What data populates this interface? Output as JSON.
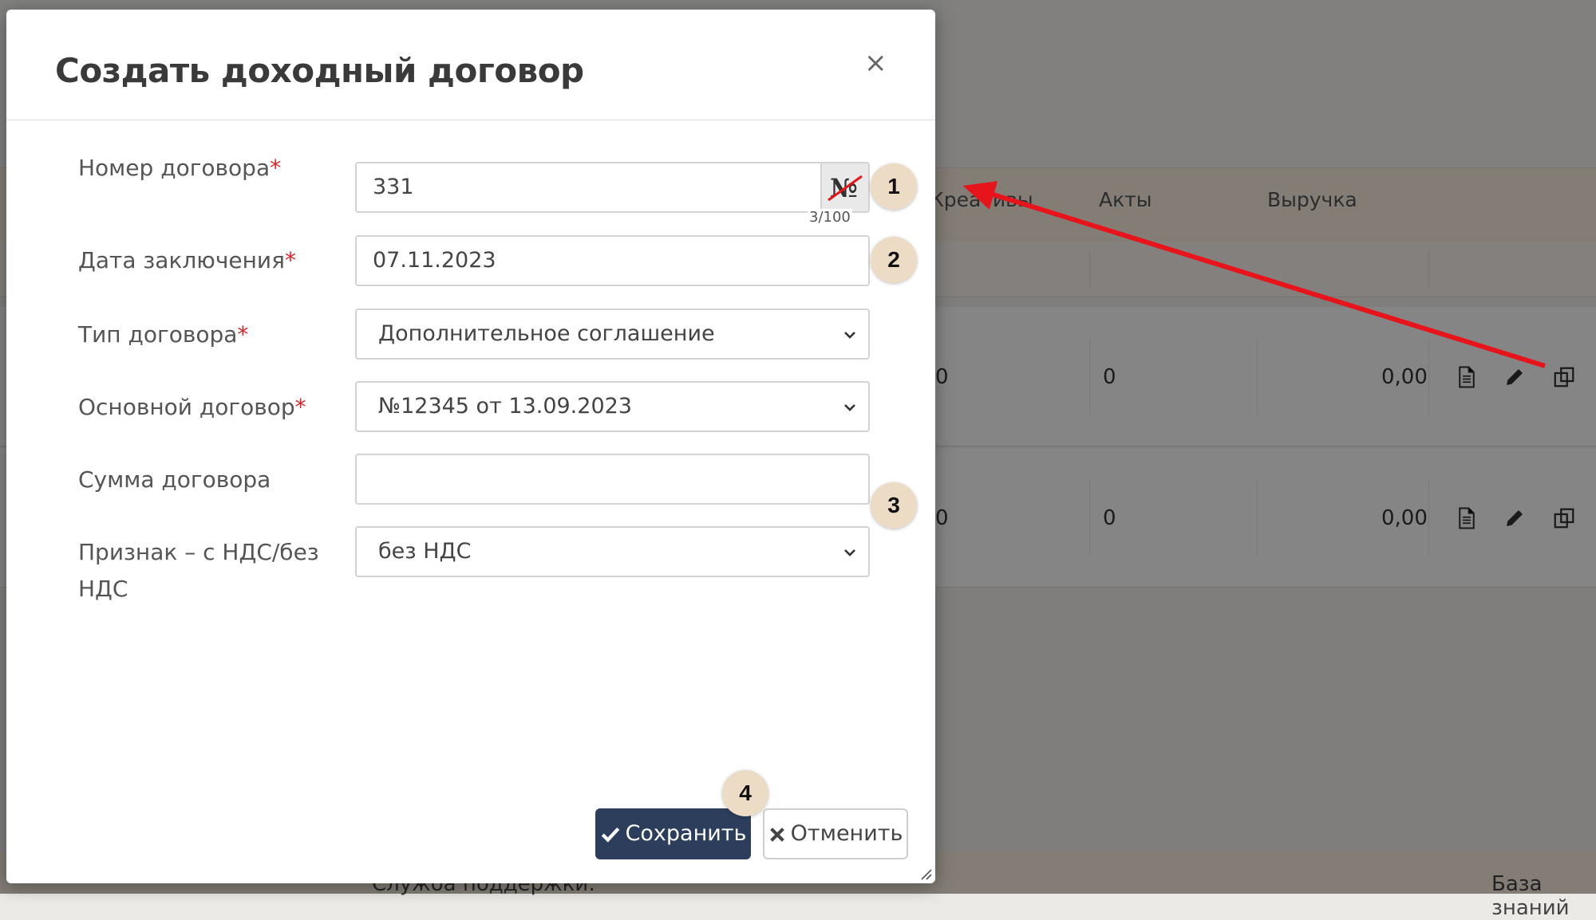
{
  "background": {
    "columns": [
      "Креативы",
      "Акты",
      "Выручка"
    ],
    "rows": [
      {
        "creatives": "0",
        "acts": "0",
        "revenue": "0,00"
      },
      {
        "creatives": "0",
        "acts": "0",
        "revenue": "0,00"
      }
    ],
    "row_icons": [
      "document-icon",
      "pencil-icon",
      "copy-icon"
    ],
    "footer_left": "Служба поддержки:",
    "footer_right": "База знаний"
  },
  "modal": {
    "title": "Создать доходный договор",
    "close_label": "×",
    "fields": {
      "contract_number": {
        "label": "Номер договора",
        "required": "*",
        "value": "331",
        "counter": "3/100",
        "addon_icon": "numero-crossed-icon"
      },
      "conclusion_date": {
        "label": "Дата заключения",
        "required": "*",
        "value": "07.11.2023"
      },
      "contract_type": {
        "label": "Тип договора",
        "required": "*",
        "value": "Дополнительное соглашение"
      },
      "main_contract": {
        "label": "Основной договор",
        "required": "*",
        "value": "№12345 от 13.09.2023"
      },
      "contract_amount": {
        "label": "Сумма договора",
        "value": ""
      },
      "vat_flag": {
        "label_line1": "Признак – с НДС/без",
        "label_line2": "НДС",
        "value": "без НДС"
      }
    },
    "buttons": {
      "save": "Сохранить",
      "cancel": "Отменить"
    }
  },
  "annotations": {
    "badges": [
      "1",
      "2",
      "3",
      "4"
    ],
    "arrow_color": "#e8141b"
  },
  "colors": {
    "primary": "#2c3e5b",
    "required": "#d9252c",
    "badge": "#ecdcc6"
  }
}
